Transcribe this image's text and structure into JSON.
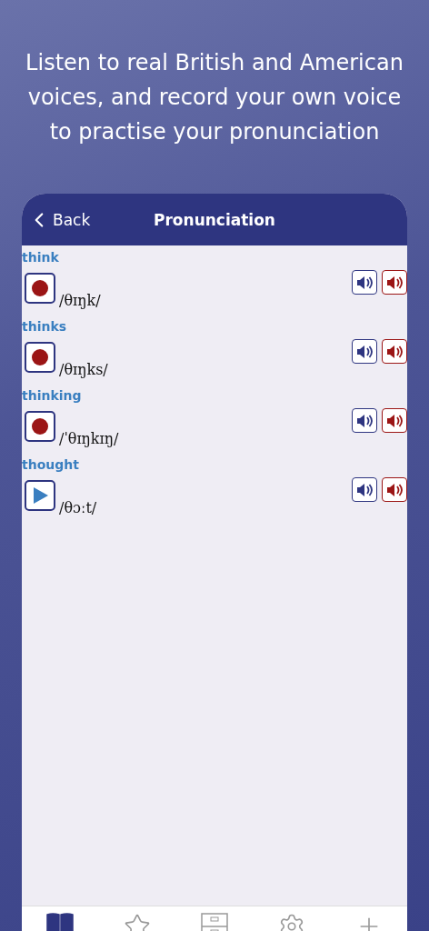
{
  "headline": "Listen to real British and American voices, and record your own voice to practise your pronunciation",
  "nav": {
    "back": "Back",
    "title": "Pronunciation"
  },
  "entries": [
    {
      "word": "think",
      "phonetic": "/θɪŋk/",
      "kind": "record"
    },
    {
      "word": "thinks",
      "phonetic": "/θɪŋks/",
      "kind": "record"
    },
    {
      "word": "thinking",
      "phonetic": "/ˈθɪŋkɪŋ/",
      "kind": "record"
    },
    {
      "word": "thought",
      "phonetic": "/θɔːt/",
      "kind": "play"
    }
  ],
  "tabs": [
    {
      "kind": "book",
      "selected": true
    },
    {
      "kind": "star",
      "selected": false
    },
    {
      "kind": "cabinet",
      "selected": false
    },
    {
      "kind": "gear",
      "selected": false
    },
    {
      "kind": "plus",
      "selected": false
    }
  ]
}
